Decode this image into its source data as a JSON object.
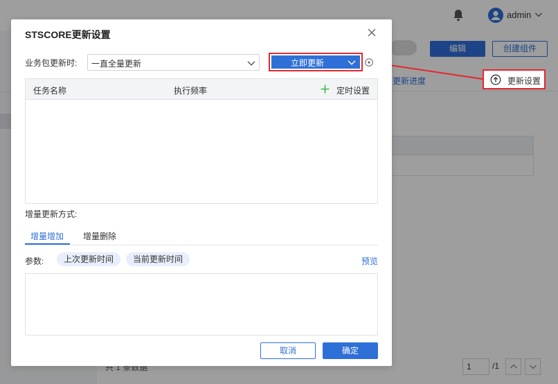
{
  "topbar": {
    "username": "admin"
  },
  "background": {
    "edit_label": "编辑",
    "create_component_label": "创建组件",
    "progress_tab": "更新进度",
    "update_settings_label": "更新设置",
    "footer_text": "共 1 条数据",
    "page_current": "1",
    "page_total": "/1"
  },
  "dialog": {
    "title": "STSCORE更新设置",
    "update_mode_label": "业务包更新时:",
    "update_mode_value": "一直全量更新",
    "update_now_label": "立即更新",
    "table": {
      "col_task": "任务名称",
      "col_frequency": "执行频率",
      "schedule_label": "定时设置"
    },
    "incremental_label": "增量更新方式:",
    "tabs": [
      "增量增加",
      "增量删除"
    ],
    "params_label": "参数:",
    "param_chips": [
      "上次更新时间",
      "当前更新时间"
    ],
    "preview_label": "预览",
    "cancel_label": "取消",
    "ok_label": "确定"
  },
  "colors": {
    "accent": "#2f6fd8",
    "highlight": "#e8262d",
    "add": "#3bb54a"
  }
}
